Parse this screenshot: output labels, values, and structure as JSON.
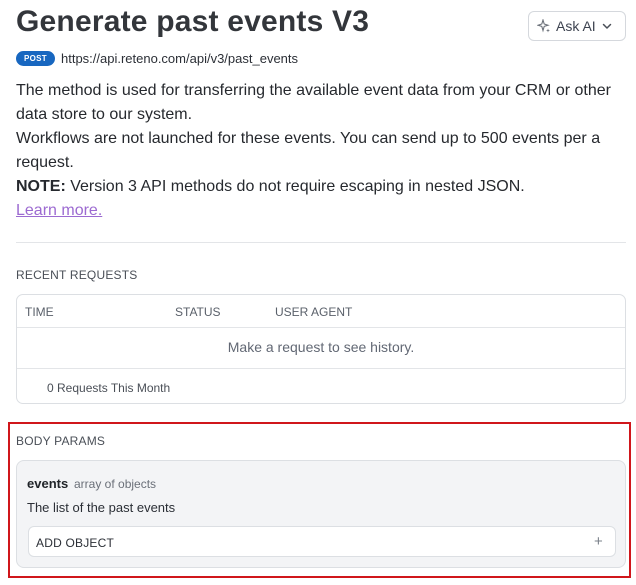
{
  "header": {
    "title": "Generate past events V3",
    "ask_ai_label": "Ask AI"
  },
  "endpoint": {
    "method": "POST",
    "url": "https://api.reteno.com/api/v3/past_events"
  },
  "description": {
    "line1": "The method is used for transferring the available event data from your CRM or other data store to our system.",
    "line2": "Workflows are not launched for these events. You can send up to 500 events per a request.",
    "note_label": "NOTE:",
    "note_text": " Version 3 API methods do not require escaping in nested JSON.",
    "learn_more": "Learn more."
  },
  "recent_requests": {
    "title": "RECENT REQUESTS",
    "columns": [
      "TIME",
      "STATUS",
      "USER AGENT"
    ],
    "empty_text": "Make a request to see history.",
    "footer": "0 Requests This Month"
  },
  "body_params": {
    "title": "BODY PARAMS",
    "param": {
      "name": "events",
      "type": "array of objects",
      "description": "The list of the past events",
      "add_label": "ADD OBJECT",
      "add_icon": "+"
    }
  },
  "colors": {
    "badge": "#1867c0",
    "link": "#9c6ad1",
    "highlight": "#d0161b"
  }
}
